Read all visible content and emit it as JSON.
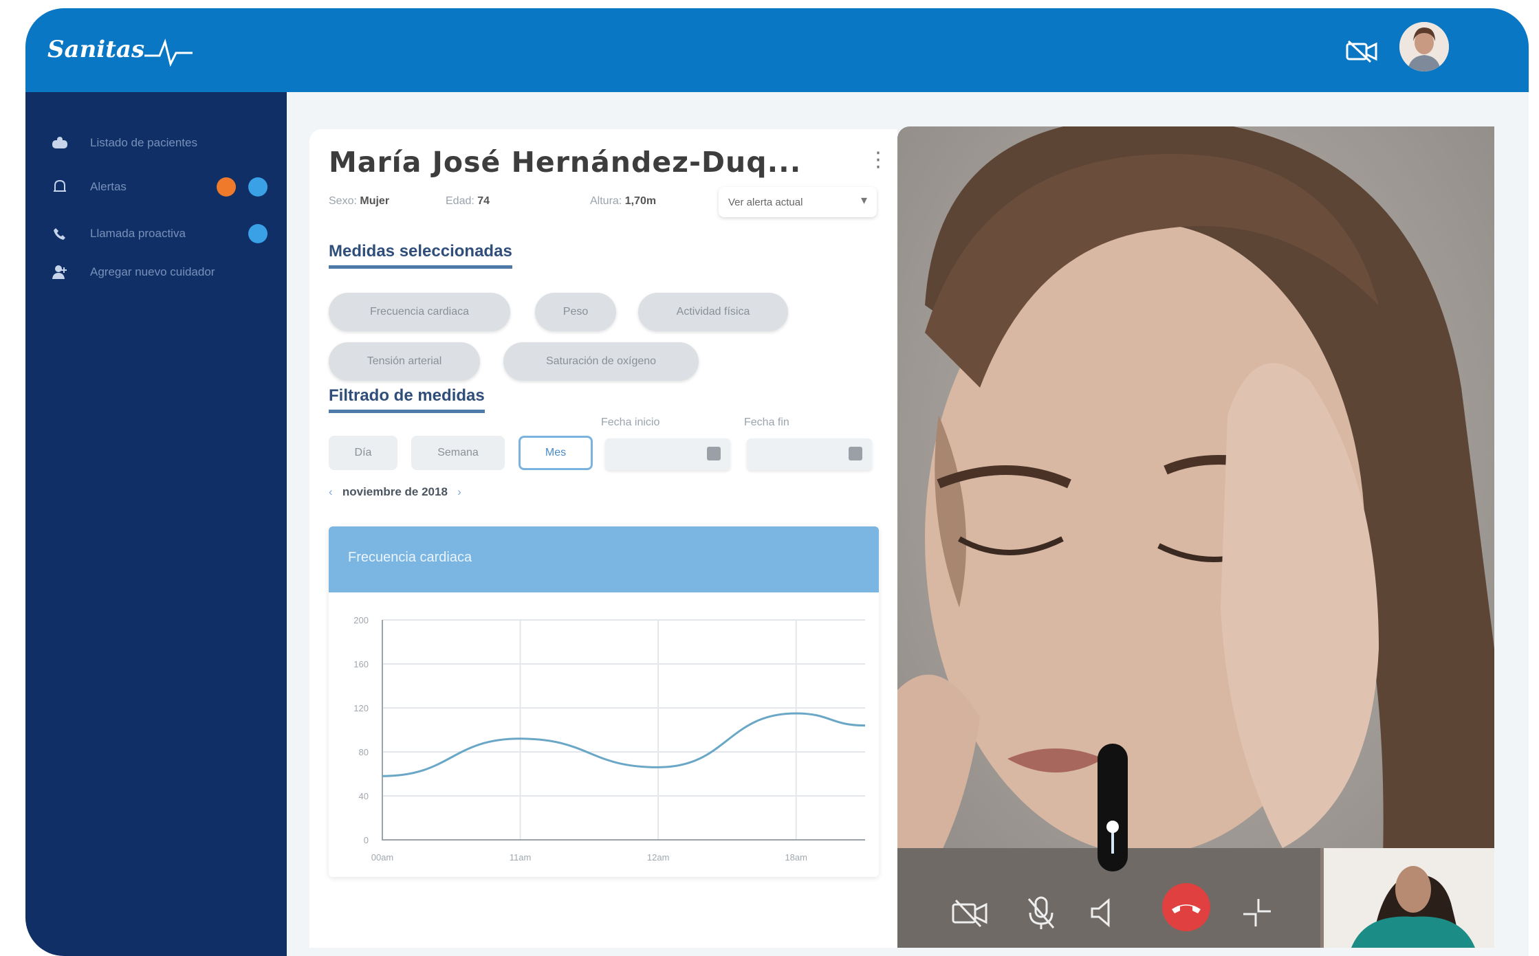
{
  "app": {
    "brand": "Sanitas",
    "brand_color": "#0a77c4",
    "sidebar_color": "#0f2f66"
  },
  "header": {
    "camera_icon": "video-camera-off-icon",
    "avatar_icon": "user-avatar"
  },
  "sidebar": {
    "items": [
      {
        "icon": "patients-icon",
        "label": "Listado de pacientes"
      },
      {
        "icon": "bell-icon",
        "label": "Alertas"
      },
      {
        "icon": "phone-icon",
        "label": "Llamada proactiva"
      },
      {
        "icon": "add-user-icon",
        "label": "Agregar nuevo cuidador"
      }
    ],
    "badge_colors": {
      "orange": "#f07a2b",
      "blue": "#3aa1e6"
    }
  },
  "patient": {
    "name": "María José Hernández-Duq...",
    "sex_label": "Sexo:",
    "sex_value": "Mujer",
    "age_label": "Edad:",
    "age_value": "74",
    "height_label": "Altura:",
    "height_value": "1,70m",
    "alert_button": "Ver alerta actual"
  },
  "measures": {
    "title": "Medidas seleccionadas",
    "chips": [
      "Frecuencia cardiaca",
      "Peso",
      "Actividad física",
      "Tensión arterial",
      "Saturación de oxígeno"
    ]
  },
  "filter": {
    "title": "Filtrado de medidas",
    "segments": [
      "Día",
      "Semana",
      "Mes"
    ],
    "active_segment": "Mes",
    "start_label": "Fecha inicio",
    "end_label": "Fecha fin",
    "month": "noviembre de 2018",
    "prev_arrow": "‹",
    "next_arrow": "›"
  },
  "chart_data": {
    "type": "line",
    "title": "Frecuencia cardiaca",
    "x": [
      "00am",
      "11am",
      "12am",
      "18am"
    ],
    "y_ticks": [
      0,
      40,
      80,
      120,
      160,
      200
    ],
    "ylim": [
      0,
      200
    ],
    "series": [
      {
        "values": [
          [
            0,
            58
          ],
          [
            1,
            92
          ],
          [
            2,
            66
          ],
          [
            3,
            115
          ],
          [
            3.5,
            104
          ]
        ]
      }
    ],
    "grid": true,
    "line_color": "#6aa7c7"
  },
  "call": {
    "controls": [
      "camera-off-icon",
      "mic-off-icon",
      "speaker-icon",
      "hang-up-icon",
      "minimize-icon"
    ],
    "volume_level": 0.3
  }
}
